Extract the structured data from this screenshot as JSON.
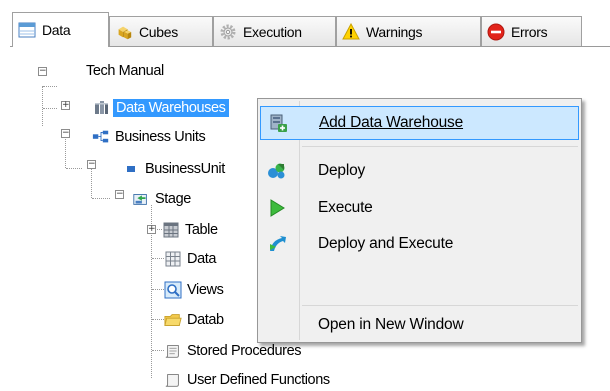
{
  "tabs": [
    {
      "label": "Data",
      "icon": "table-icon",
      "active": true
    },
    {
      "label": "Cubes",
      "icon": "cubes-icon"
    },
    {
      "label": "Execution",
      "icon": "gear-icon"
    },
    {
      "label": "Warnings",
      "icon": "warning-icon"
    },
    {
      "label": "Errors",
      "icon": "error-icon"
    }
  ],
  "tree": {
    "root": "Tech Manual",
    "data_warehouses": "Data Warehouses",
    "business_units": "Business Units",
    "business_unit": "BusinessUnit",
    "stage": "Stage",
    "tables": "Table",
    "data": "Data",
    "views": "Views",
    "databases": "Datab",
    "stored_procedures": "Stored Procedures",
    "user_defined_functions": "User Defined Functions"
  },
  "context_menu": {
    "add_data_warehouse": "Add Data Warehouse",
    "deploy": "Deploy",
    "execute": "Execute",
    "deploy_and_execute": "Deploy and Execute",
    "open_in_new_window": "Open in New Window"
  },
  "colors": {
    "selection": "#3399ff",
    "menu_hover": "#cce8ff",
    "menu_background": "#f0f0f0"
  }
}
